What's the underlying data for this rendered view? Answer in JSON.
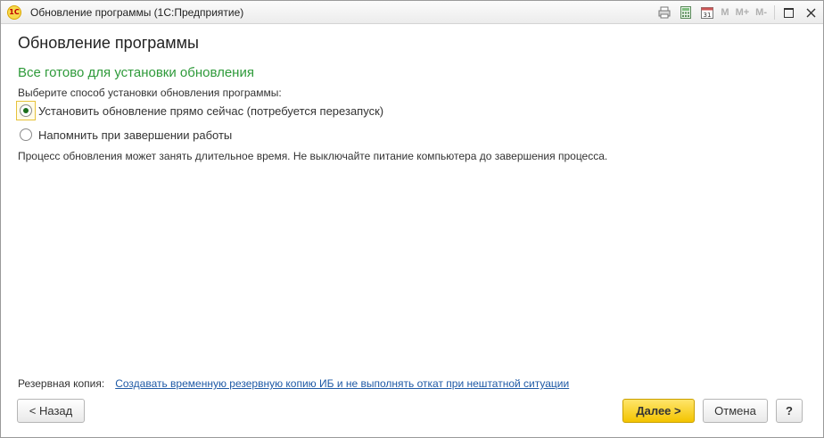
{
  "window": {
    "logo_text": "1С",
    "title": "Обновление программы  (1С:Предприятие)",
    "mem_buttons": [
      "M",
      "M+",
      "M-"
    ],
    "icons": [
      "print-icon",
      "calculator-icon",
      "calendar-icon",
      "restore-window-icon",
      "close-icon"
    ],
    "calendar_number": "31"
  },
  "page": {
    "title": "Обновление программы",
    "section_title": "Все готово для установки обновления",
    "prompt": "Выберите способ установки обновления программы:",
    "options": [
      {
        "label": "Установить обновление прямо сейчас (потребуется перезапуск)",
        "selected": true
      },
      {
        "label": "Напомнить при завершении работы",
        "selected": false
      }
    ],
    "note": "Процесс обновления может занять длительное время. Не выключайте питание компьютера до завершения процесса."
  },
  "backup": {
    "label": "Резервная копия:",
    "link": "Создавать временную резервную копию ИБ и не выполнять откат при нештатной ситуации"
  },
  "buttons": {
    "back": "< Назад",
    "next": "Далее >",
    "cancel": "Отмена",
    "help": "?"
  },
  "colors": {
    "section_title": "#2e9a3a",
    "link": "#1f5aa6",
    "primary_button": "#f3c400"
  }
}
